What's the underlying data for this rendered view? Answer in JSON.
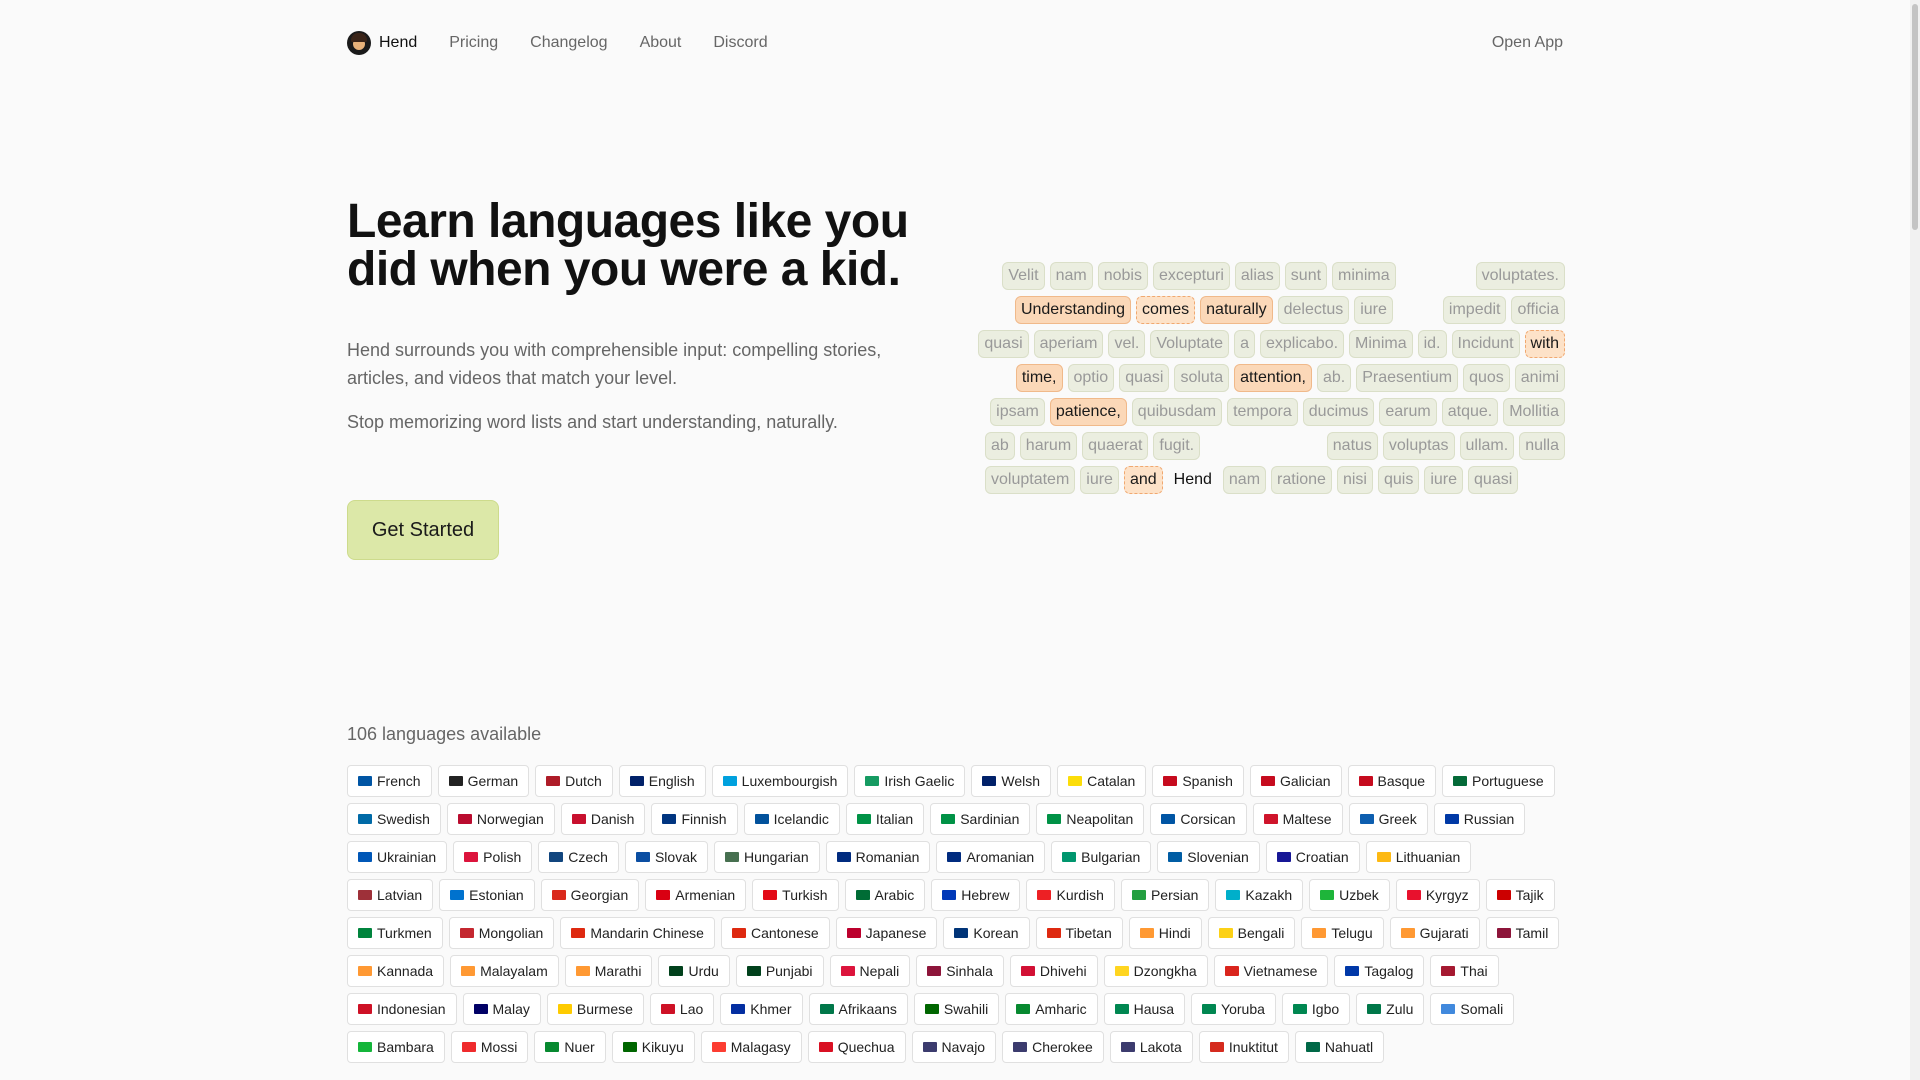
{
  "nav": {
    "brand": "Hend",
    "links": [
      "Pricing",
      "Changelog",
      "About",
      "Discord"
    ],
    "open_app": "Open App"
  },
  "hero": {
    "title": "Learn languages like you did when you were a kid.",
    "p1": "Hend surrounds you with comprehensible input: compelling stories, articles, and videos that match your level.",
    "p2": "Stop memorizing word lists and start understanding, naturally.",
    "cta": "Get Started"
  },
  "cloud": [
    [
      [
        "Velit",
        "n"
      ],
      [
        "nam",
        "n"
      ],
      [
        "nobis",
        "n"
      ],
      [
        "excepturi",
        "n"
      ],
      [
        "alias",
        "n"
      ],
      [
        "sunt",
        "n"
      ],
      [
        "minima",
        "n"
      ],
      [
        "__gap70",
        ""
      ],
      [
        "voluptates.",
        "n"
      ]
    ],
    [
      [
        "Understanding",
        "h"
      ],
      [
        "comes",
        "s"
      ],
      [
        "naturally",
        "h"
      ],
      [
        "delectus",
        "n"
      ],
      [
        "iure",
        "n"
      ],
      [
        "__gap40",
        ""
      ],
      [
        "impedit",
        "n"
      ],
      [
        "officia",
        "n"
      ]
    ],
    [
      [
        "quasi",
        "n"
      ],
      [
        "aperiam",
        "n"
      ],
      [
        "vel.",
        "n"
      ],
      [
        "Voluptate",
        "n"
      ],
      [
        "a",
        "n"
      ],
      [
        "explicabo.",
        "n"
      ],
      [
        "Minima",
        "n"
      ],
      [
        "id.",
        "n"
      ],
      [
        "Incidunt",
        "n"
      ],
      [
        "with",
        "s"
      ]
    ],
    [
      [
        "time,",
        "h"
      ],
      [
        "optio",
        "n"
      ],
      [
        "quasi",
        "n"
      ],
      [
        "soluta",
        "n"
      ],
      [
        "attention,",
        "h"
      ],
      [
        "ab.",
        "n"
      ],
      [
        "Praesentium",
        "n"
      ],
      [
        "quos",
        "n"
      ],
      [
        "animi",
        "n"
      ]
    ],
    [
      [
        "ipsam",
        "n"
      ],
      [
        "patience,",
        "h"
      ],
      [
        "quibusdam",
        "n"
      ],
      [
        "tempora",
        "n"
      ],
      [
        "ducimus",
        "n"
      ],
      [
        "earum",
        "n"
      ],
      [
        "atque.",
        "n"
      ],
      [
        "Mollitia",
        "n"
      ]
    ],
    [
      [
        "ab",
        "n"
      ],
      [
        "harum",
        "n"
      ],
      [
        "quaerat",
        "n"
      ],
      [
        "fugit.",
        "n"
      ],
      [
        "__gap120",
        ""
      ],
      [
        "natus",
        "n"
      ],
      [
        "voluptas",
        "n"
      ],
      [
        "ullam.",
        "n"
      ],
      [
        "nulla",
        "n"
      ]
    ],
    [
      [
        "voluptatem",
        "n"
      ],
      [
        "iure",
        "n"
      ],
      [
        "and",
        "s"
      ],
      [
        "Hend",
        "p"
      ],
      [
        "nam",
        "n"
      ],
      [
        "ratione",
        "n"
      ],
      [
        "nisi",
        "n"
      ],
      [
        "quis",
        "n"
      ],
      [
        "iure",
        "n"
      ],
      [
        "quasi",
        "n"
      ],
      [
        "__gap62",
        ""
      ]
    ]
  ],
  "languages": {
    "count_label": "106 languages available",
    "items": [
      [
        "French",
        "#0055a4"
      ],
      [
        "German",
        "#222"
      ],
      [
        "Dutch",
        "#ae1c28"
      ],
      [
        "English",
        "#012169"
      ],
      [
        "Luxembourgish",
        "#00a1de"
      ],
      [
        "Irish Gaelic",
        "#169b62"
      ],
      [
        "Welsh",
        "#012169"
      ],
      [
        "Catalan",
        "#fcdd09"
      ],
      [
        "Spanish",
        "#c60b1e"
      ],
      [
        "Galician",
        "#c60b1e"
      ],
      [
        "Basque",
        "#c60b1e"
      ],
      [
        "Portuguese",
        "#046a38"
      ],
      [
        "Swedish",
        "#006aa7"
      ],
      [
        "Norwegian",
        "#ba0c2f"
      ],
      [
        "Danish",
        "#c8102e"
      ],
      [
        "Finnish",
        "#003580"
      ],
      [
        "Icelandic",
        "#02529c"
      ],
      [
        "Italian",
        "#009246"
      ],
      [
        "Sardinian",
        "#009246"
      ],
      [
        "Neapolitan",
        "#009246"
      ],
      [
        "Corsican",
        "#0055a4"
      ],
      [
        "Maltese",
        "#cf142b"
      ],
      [
        "Greek",
        "#0d5eaf"
      ],
      [
        "Russian",
        "#0039a6"
      ],
      [
        "Ukrainian",
        "#0057b7"
      ],
      [
        "Polish",
        "#dc143c"
      ],
      [
        "Czech",
        "#11457e"
      ],
      [
        "Slovak",
        "#0b4ea2"
      ],
      [
        "Hungarian",
        "#477050"
      ],
      [
        "Romanian",
        "#002b7f"
      ],
      [
        "Aromanian",
        "#002b7f"
      ],
      [
        "Bulgarian",
        "#00966e"
      ],
      [
        "Slovenian",
        "#005da4"
      ],
      [
        "Croatian",
        "#171796"
      ],
      [
        "Lithuanian",
        "#fdb913"
      ],
      [
        "Latvian",
        "#9e3039"
      ],
      [
        "Estonian",
        "#0072ce"
      ],
      [
        "Georgian",
        "#da291c"
      ],
      [
        "Armenian",
        "#d90012"
      ],
      [
        "Turkish",
        "#e30a17"
      ],
      [
        "Arabic",
        "#006c35"
      ],
      [
        "Hebrew",
        "#0038b8"
      ],
      [
        "Kurdish",
        "#ed2024"
      ],
      [
        "Persian",
        "#239f40"
      ],
      [
        "Kazakh",
        "#00afca"
      ],
      [
        "Uzbek",
        "#1eb53a"
      ],
      [
        "Kyrgyz",
        "#e8112d"
      ],
      [
        "Tajik",
        "#cc0000"
      ],
      [
        "Turkmen",
        "#00843d"
      ],
      [
        "Mongolian",
        "#c4272f"
      ],
      [
        "Mandarin Chinese",
        "#de2910"
      ],
      [
        "Cantonese",
        "#de2910"
      ],
      [
        "Japanese",
        "#bc002d"
      ],
      [
        "Korean",
        "#003478"
      ],
      [
        "Tibetan",
        "#de2910"
      ],
      [
        "Hindi",
        "#ff9933"
      ],
      [
        "Bengali",
        "#fcd116"
      ],
      [
        "Telugu",
        "#ff9933"
      ],
      [
        "Gujarati",
        "#ff9933"
      ],
      [
        "Tamil",
        "#8d153a"
      ],
      [
        "Kannada",
        "#ff9933"
      ],
      [
        "Malayalam",
        "#ff9933"
      ],
      [
        "Marathi",
        "#ff9933"
      ],
      [
        "Urdu",
        "#01411c"
      ],
      [
        "Punjabi",
        "#01411c"
      ],
      [
        "Nepali",
        "#dc143c"
      ],
      [
        "Sinhala",
        "#8d153a"
      ],
      [
        "Dhivehi",
        "#d21034"
      ],
      [
        "Dzongkha",
        "#ffd520"
      ],
      [
        "Vietnamese",
        "#da251d"
      ],
      [
        "Tagalog",
        "#0038a8"
      ],
      [
        "Thai",
        "#a51931"
      ],
      [
        "Indonesian",
        "#ce1126"
      ],
      [
        "Malay",
        "#010066"
      ],
      [
        "Burmese",
        "#fecb00"
      ],
      [
        "Lao",
        "#ce1126"
      ],
      [
        "Khmer",
        "#032ea1"
      ],
      [
        "Afrikaans",
        "#007749"
      ],
      [
        "Swahili",
        "#006600"
      ],
      [
        "Amharic",
        "#078930"
      ],
      [
        "Hausa",
        "#008751"
      ],
      [
        "Yoruba",
        "#008751"
      ],
      [
        "Igbo",
        "#008751"
      ],
      [
        "Zulu",
        "#007749"
      ],
      [
        "Somali",
        "#4189dd"
      ],
      [
        "Bambara",
        "#14b53a"
      ],
      [
        "Mossi",
        "#ef2b2d"
      ],
      [
        "Nuer",
        "#078930"
      ],
      [
        "Kikuyu",
        "#006600"
      ],
      [
        "Malagasy",
        "#fc3d32"
      ],
      [
        "Quechua",
        "#d91023"
      ],
      [
        "Navajo",
        "#3c3b6e"
      ],
      [
        "Cherokee",
        "#3c3b6e"
      ],
      [
        "Lakota",
        "#3c3b6e"
      ],
      [
        "Inuktitut",
        "#d52b1e"
      ],
      [
        "Nahuatl",
        "#006847"
      ]
    ]
  }
}
